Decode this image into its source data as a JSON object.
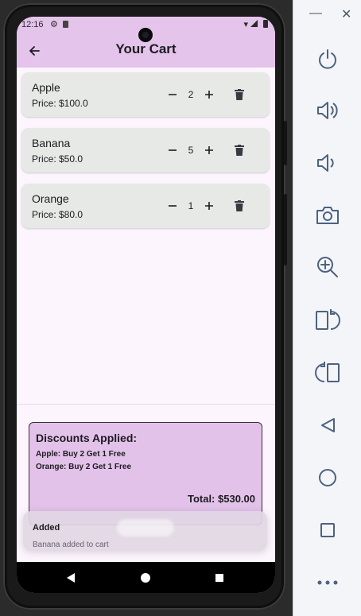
{
  "status_bar": {
    "time": "12:16"
  },
  "app_bar": {
    "title": "Your Cart"
  },
  "cart": {
    "items": [
      {
        "name": "Apple",
        "price": "Price: $100.0",
        "qty": "2"
      },
      {
        "name": "Banana",
        "price": "Price: $50.0",
        "qty": "5"
      },
      {
        "name": "Orange",
        "price": "Price: $80.0",
        "qty": "1"
      }
    ]
  },
  "discounts": {
    "title": "Discounts Applied:",
    "lines": [
      "Apple: Buy 2 Get 1 Free",
      "Orange: Buy 2 Get 1 Free"
    ],
    "total": "Total: $530.00"
  },
  "snackbar": {
    "title": "Added",
    "body": "Banana added to cart"
  },
  "colors": {
    "app_bar": "#e4c4eb",
    "background": "#fdf5fd",
    "item_card": "#e6e9e6",
    "discount_box": "#e3c2ea"
  },
  "icons": {
    "back": "arrow-left-icon",
    "minus": "minus-icon",
    "plus": "plus-icon",
    "delete": "trash-icon",
    "emulator": [
      "power-icon",
      "volume-up-icon",
      "volume-down-icon",
      "camera-icon",
      "zoom-icon",
      "rotate-left-icon",
      "rotate-right-icon",
      "back-triangle-icon",
      "home-circle-icon",
      "overview-square-icon",
      "more-icon"
    ]
  },
  "emulator_window": {
    "minimize": "—",
    "close": "✕"
  }
}
